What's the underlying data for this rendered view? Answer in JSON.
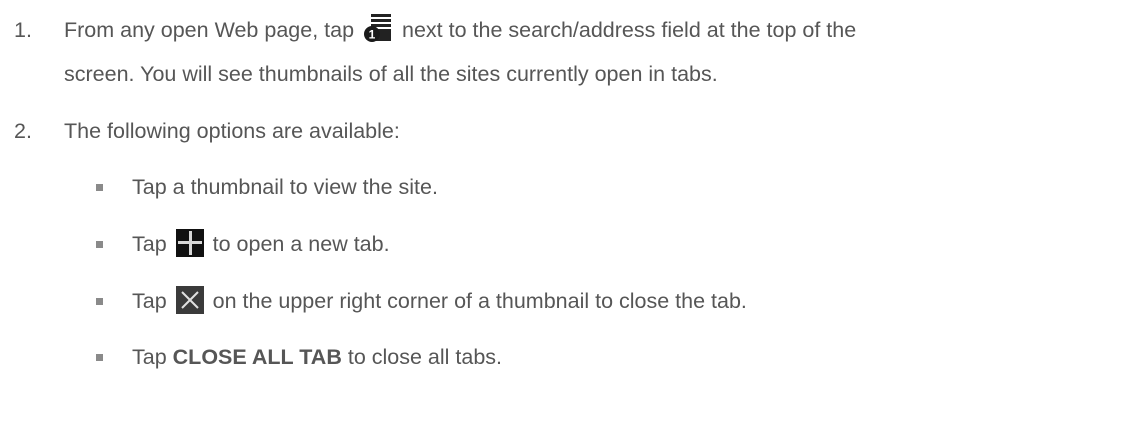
{
  "steps": [
    {
      "number": "1.",
      "line1_before": "From any open Web page, tap",
      "line1_after": "next to the search/address field at the top of the",
      "line2": "screen. You will see thumbnails of all the sites currently open in tabs."
    },
    {
      "number": "2.",
      "text": "The following options are available:"
    }
  ],
  "options": [
    {
      "text": "Tap a thumbnail to view the site."
    },
    {
      "before": "Tap",
      "after": "to open a new tab.",
      "icon": "plus-icon"
    },
    {
      "before": "Tap",
      "after": "on the upper right corner of a thumbnail to close the tab.",
      "icon": "close-icon"
    },
    {
      "before": "Tap",
      "bold": "CLOSE ALL TAB",
      "after": "to close all tabs."
    }
  ],
  "icons": {
    "tabs_icon_badge": "1",
    "tabs_icon_name": "tabs-icon"
  },
  "colors": {
    "text": "#565656",
    "bullet": "#8a8a8a"
  }
}
